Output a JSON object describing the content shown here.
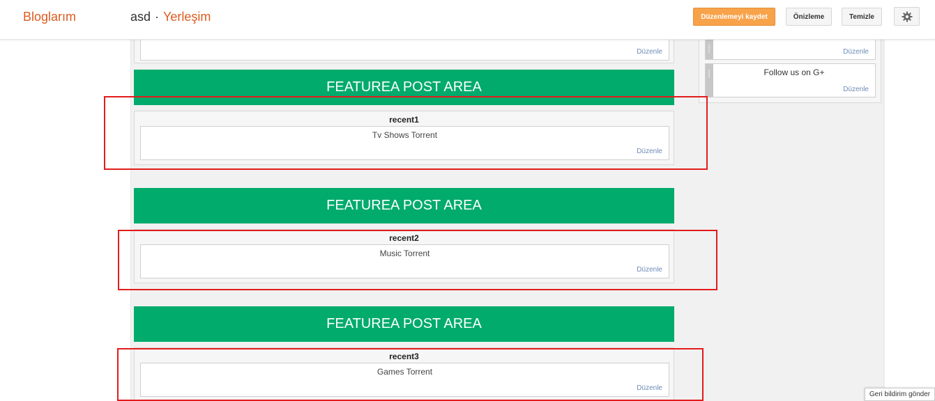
{
  "topbar": {
    "brand": "Bloglarım",
    "blog_name": "asd",
    "separator": "·",
    "page_name": "Yerleşim",
    "save_label": "Düzenlemeyi kaydet",
    "preview_label": "Önizleme",
    "clear_label": "Temizle",
    "settings_icon": "gear-icon"
  },
  "main": {
    "top_gadget_edit": "Düzenle",
    "sections": [
      {
        "banner": "FEATUREA POST AREA",
        "section_title": "recent1",
        "gadget_name": "Tv Shows Torrent",
        "edit_label": "Düzenle"
      },
      {
        "banner": "FEATUREA POST AREA",
        "section_title": "recent2",
        "gadget_name": "Music Torrent",
        "edit_label": "Düzenle"
      },
      {
        "banner": "FEATUREA POST AREA",
        "section_title": "recent3",
        "gadget_name": "Games Torrent",
        "edit_label": "Düzenle"
      }
    ]
  },
  "sidebar": {
    "gadgets": [
      {
        "title": "",
        "edit_label": "Düzenle"
      },
      {
        "title": "Follow us on G+",
        "edit_label": "Düzenle"
      }
    ]
  },
  "feedback_label": "Geri bildirim gönder",
  "colors": {
    "accent": "#dd5c1f",
    "banner": "#00ab6c",
    "save_button": "#f8a24a",
    "highlight": "#e31b1b",
    "link": "#6d8bb5"
  }
}
